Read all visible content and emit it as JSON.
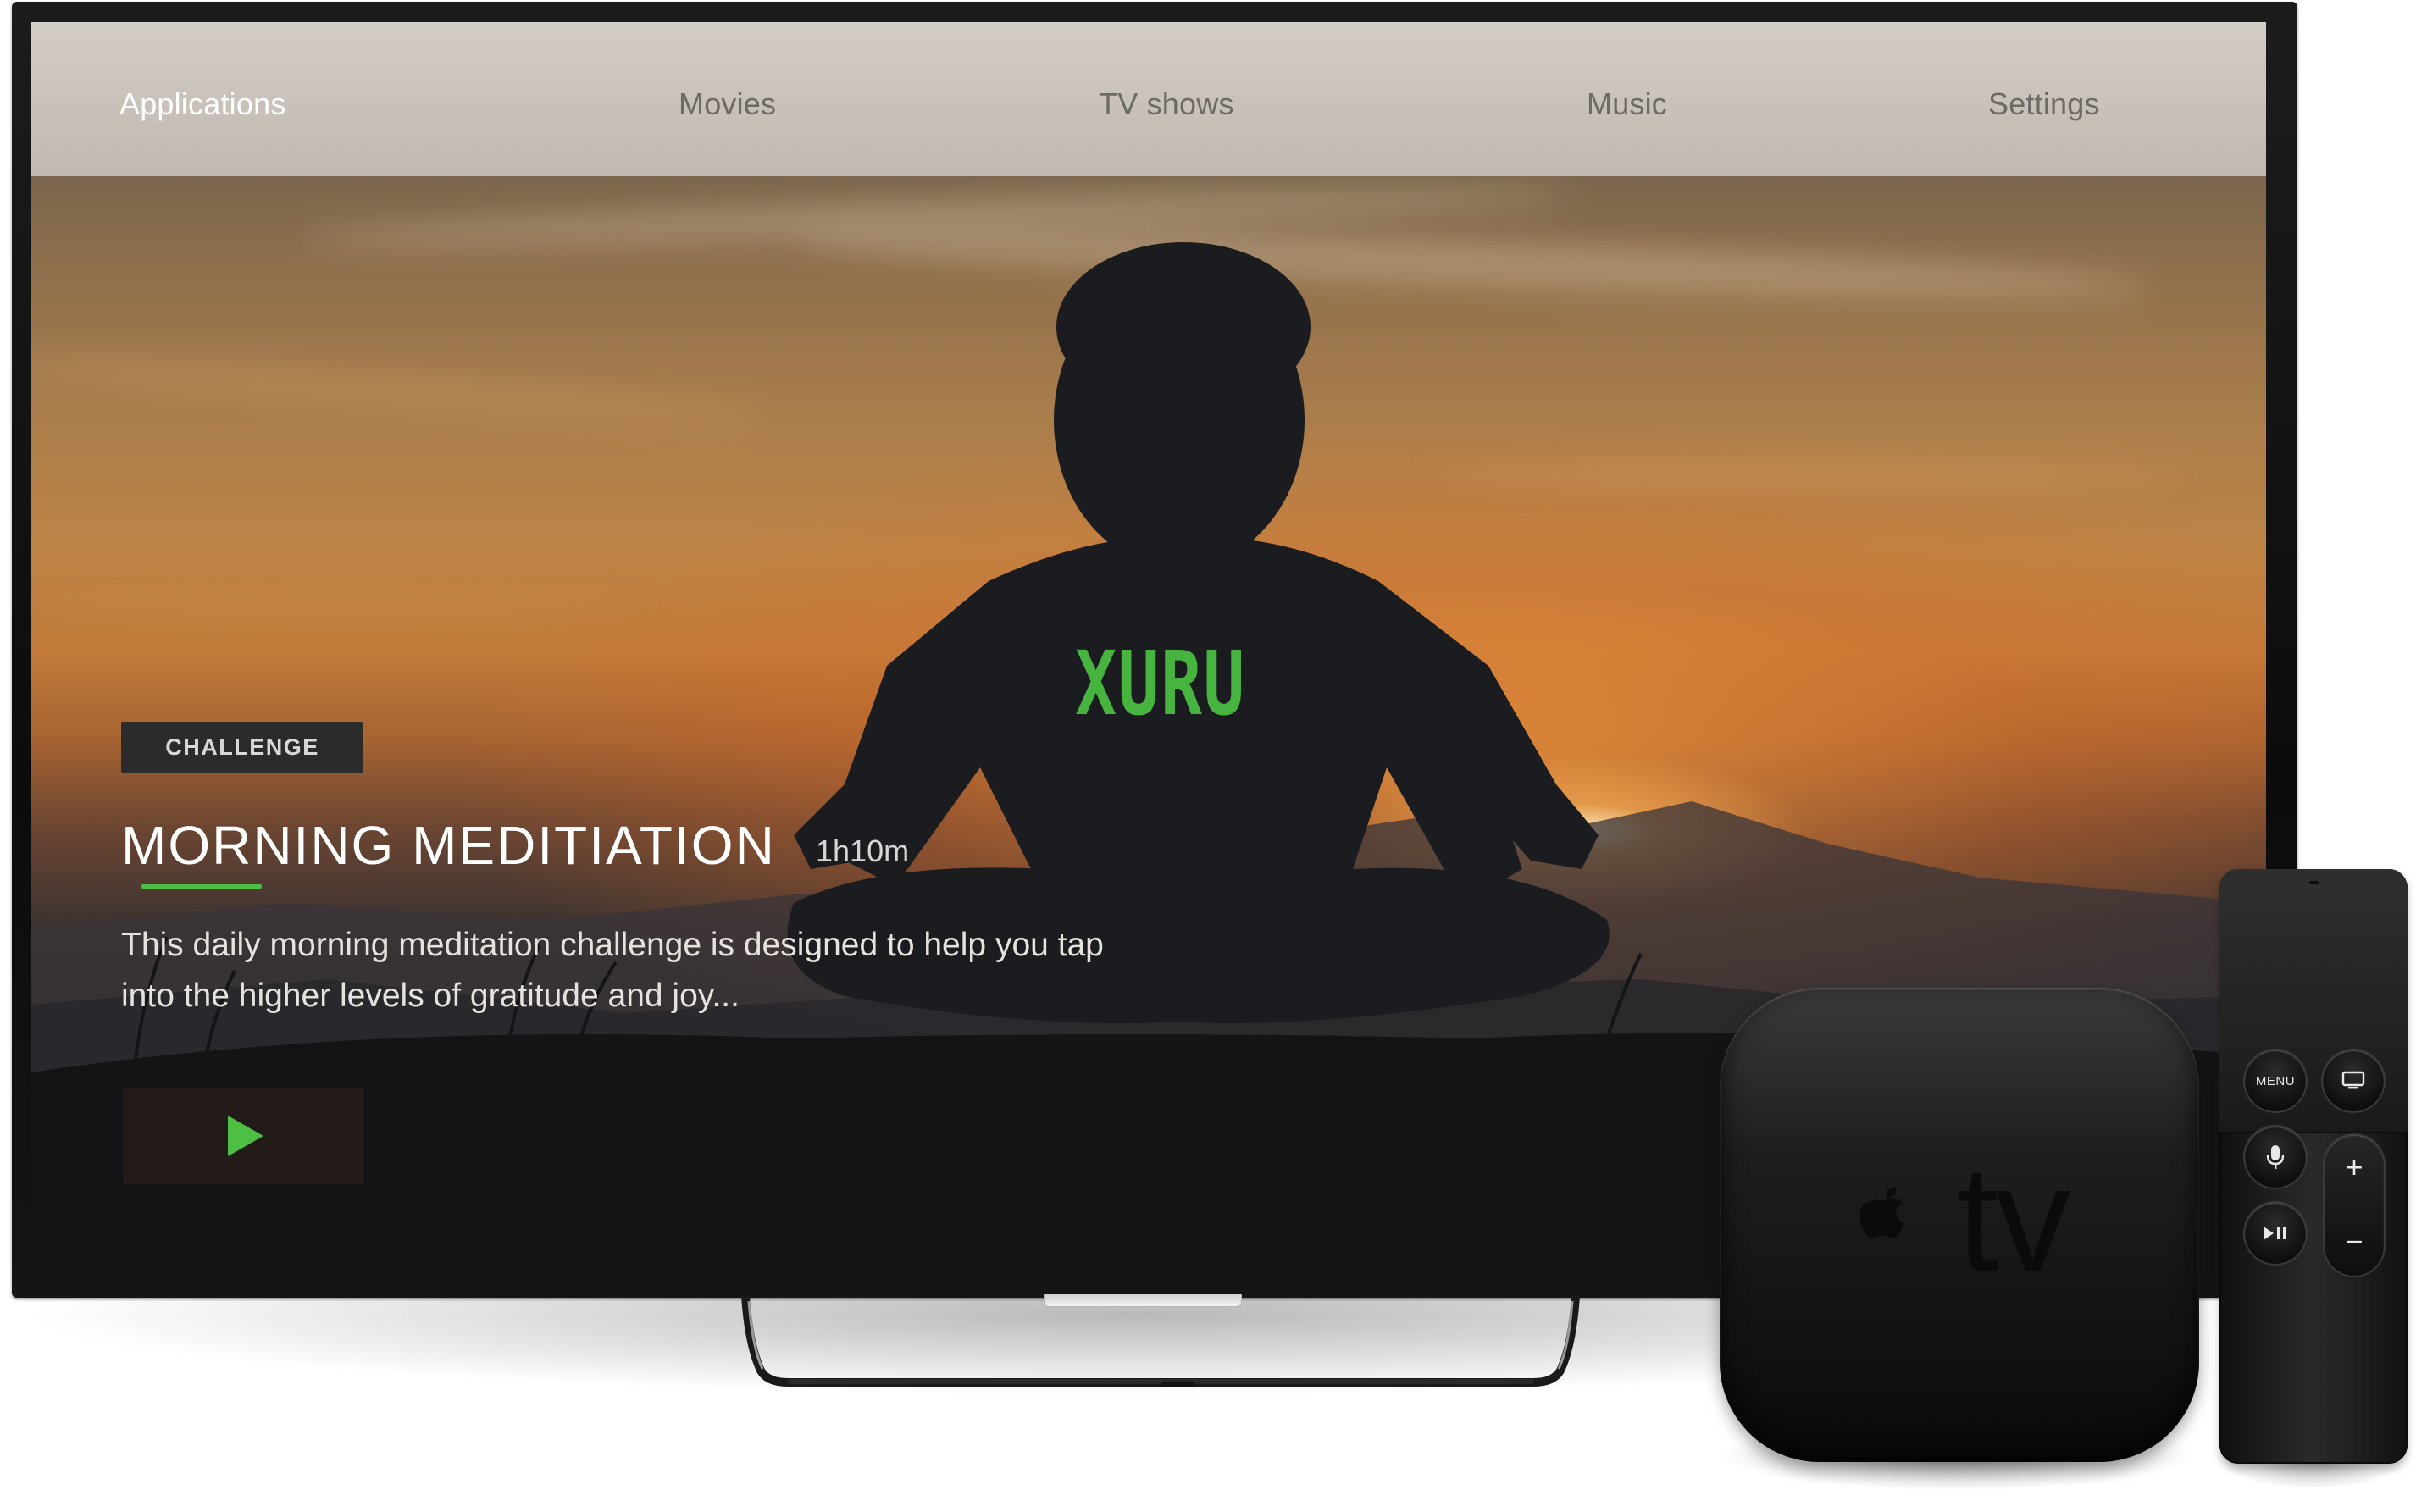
{
  "nav": {
    "items": [
      {
        "label": "Applications",
        "active": true
      },
      {
        "label": "Movies",
        "active": false
      },
      {
        "label": "TV shows",
        "active": false
      },
      {
        "label": "Music",
        "active": false
      },
      {
        "label": "Settings",
        "active": false
      }
    ]
  },
  "featured": {
    "badge": "CHALLENGE",
    "title": "MORNING MEDITIATION",
    "duration": "1h10m",
    "description": "This daily morning meditation challenge is designed to help you tap\ninto the higher levels of gratitude and joy...",
    "play_icon": "play-icon",
    "shirt_text": "XURU"
  },
  "device": {
    "logo_text": "tv",
    "logo_icon": "apple-icon"
  },
  "remote": {
    "menu_label": "MENU",
    "tv_icon": "tv-icon",
    "mic_icon": "microphone-icon",
    "play_pause_icon": "play-pause-icon",
    "volume_up": "+",
    "volume_down": "−"
  },
  "colors": {
    "accent": "#4cbf44",
    "nav_bg": "#d2ccc6",
    "badge_bg": "#2b2b2b",
    "device_body": "#111111"
  }
}
